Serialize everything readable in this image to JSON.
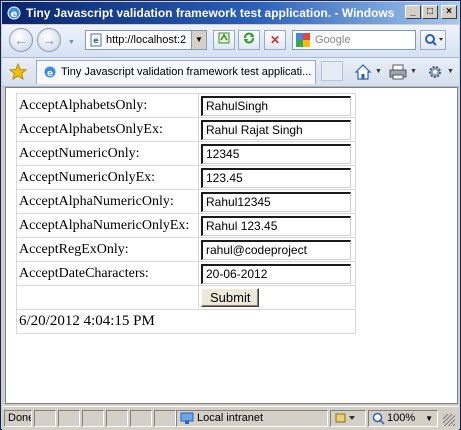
{
  "window": {
    "title": "Tiny Javascript validation framework test application. - Windows ..."
  },
  "nav": {
    "address": "http://localhost:2",
    "search_placeholder": "Google"
  },
  "tab": {
    "label": "Tiny Javascript validation framework test applicati..."
  },
  "form": {
    "rows": [
      {
        "label": "AcceptAlphabetsOnly:",
        "value": "RahulSingh"
      },
      {
        "label": "AcceptAlphabetsOnlyEx:",
        "value": "Rahul Rajat Singh"
      },
      {
        "label": "AcceptNumericOnly:",
        "value": "12345"
      },
      {
        "label": "AcceptNumericOnlyEx:",
        "value": "123.45"
      },
      {
        "label": "AcceptAlphaNumericOnly:",
        "value": "Rahul12345"
      },
      {
        "label": "AcceptAlphaNumericOnlyEx:",
        "value": "Rahul 123.45"
      },
      {
        "label": "AcceptRegExOnly:",
        "value": "rahul@codeproject"
      },
      {
        "label": "AcceptDateCharacters:",
        "value": "20-06-2012"
      }
    ],
    "submit_label": "Submit",
    "timestamp": "6/20/2012 4:04:15 PM"
  },
  "status": {
    "text": "Done",
    "zone": "Local intranet",
    "zoom": "100%"
  },
  "colors": {
    "title_bar": "#0a246a",
    "chrome": "#d4d0c8",
    "nav_bg": "#e3ebf6"
  }
}
